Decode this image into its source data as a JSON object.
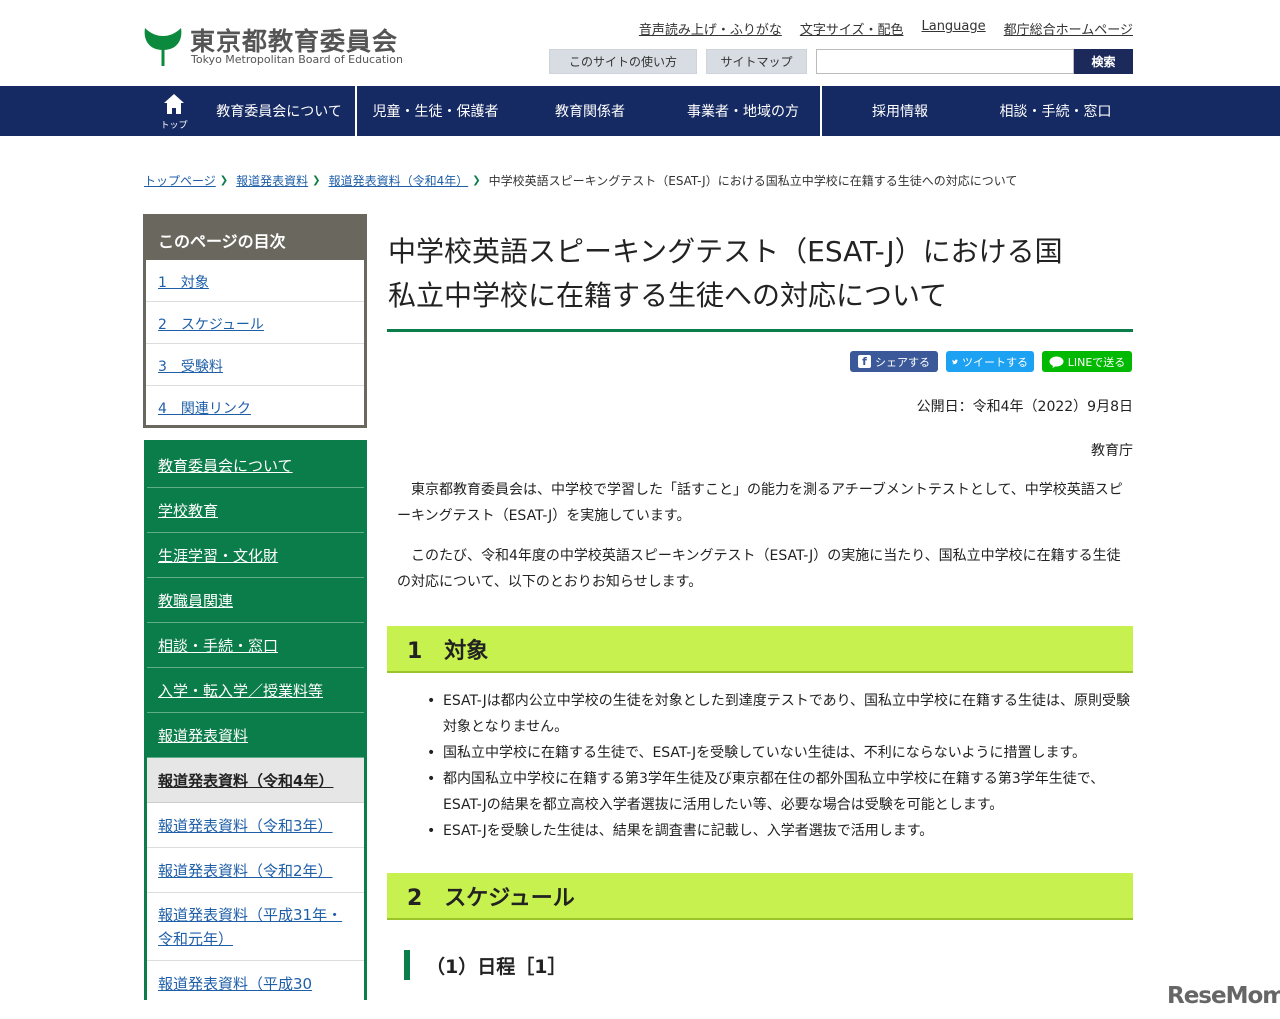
{
  "header": {
    "logo_ja": "東京都教育委員会",
    "logo_en": "Tokyo Metropolitan Board of Education",
    "util_links": [
      "音声読み上げ・ふりがな",
      "文字サイズ・配色",
      "Language",
      "都庁総合ホームページ"
    ],
    "usage_button": "このサイトの使い方",
    "sitemap_button": "サイトマップ",
    "search_placeholder": "",
    "search_button": "検索"
  },
  "gnav": {
    "home_label": "トップ",
    "items": [
      "教育委員会について",
      "児童・生徒・保護者",
      "教育関係者",
      "事業者・地域の方",
      "採用情報",
      "相談・手続・窓口"
    ]
  },
  "breadcrumb": {
    "items": [
      "トップページ",
      "報道発表資料",
      "報道発表資料（令和4年）"
    ],
    "current": "中学校英語スピーキングテスト（ESAT-J）における国私立中学校に在籍する生徒への対応について"
  },
  "toc": {
    "title": "このページの目次",
    "items": [
      "1　対象",
      "2　スケジュール",
      "3　受験料",
      "4　関連リンク"
    ]
  },
  "sidenav": {
    "main_items": [
      "教育委員会について",
      "学校教育",
      "生涯学習・文化財",
      "教職員関連",
      "相談・手続・窓口",
      "入学・転入学／授業料等",
      "報道発表資料"
    ],
    "current": "報道発表資料（令和4年）",
    "sub_items": [
      "報道発表資料（令和3年）",
      "報道発表資料（令和2年）",
      "報道発表資料（平成31年・令和元年）",
      "報道発表資料（平成30"
    ]
  },
  "main": {
    "title_line1": "中学校英語スピーキングテスト（ESAT-J）における国",
    "title_line2": "私立中学校に在籍する生徒への対応について",
    "share": {
      "facebook": "シェアする",
      "twitter": "ツイートする",
      "line": "LINEで送る"
    },
    "pub_date": "公開日：令和4年（2022）9月8日",
    "dept": "教育庁",
    "lead1": "東京都教育委員会は、中学校で学習した「話すこと」の能力を測るアチーブメントテストとして、中学校英語スピーキングテスト（ESAT-J）を実施しています。",
    "lead2": "このたび、令和4年度の中学校英語スピーキングテスト（ESAT-J）の実施に当たり、国私立中学校に在籍する生徒の対応について、以下のとおりお知らせします。",
    "section1": "1　対象",
    "bullets": [
      "ESAT-Jは都内公立中学校の生徒を対象とした到達度テストであり、国私立中学校に在籍する生徒は、原則受験対象となりません。",
      "国私立中学校に在籍する生徒で、ESAT-Jを受験していない生徒は、不利にならないように措置します。",
      "都内国私立中学校に在籍する第3学年生徒及び東京都在住の都外国私立中学校に在籍する第3学年生徒で、ESAT-Jの結果を都立高校入学者選抜に活用したい等、必要な場合は受験を可能とします。",
      "ESAT-Jを受験した生徒は、結果を調査書に記載し、入学者選抜で活用します。"
    ],
    "section2": "2　スケジュール",
    "subsection1": "（1）日程［1］"
  },
  "watermark": "ReseMom"
}
